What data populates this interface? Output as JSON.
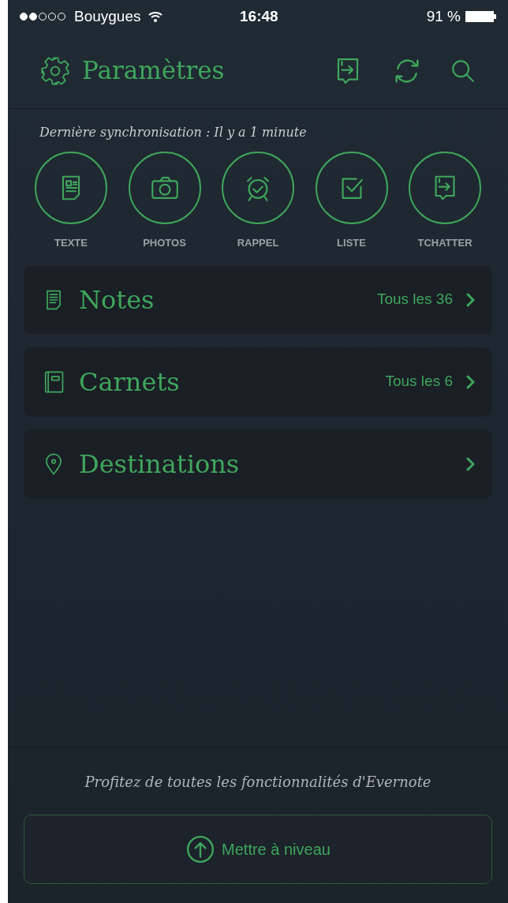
{
  "status_bar": {
    "carrier": "Bouygues",
    "time": "16:48",
    "battery": "91 %"
  },
  "header": {
    "title": "Paramètres"
  },
  "sync": "Dernière synchronisation : Il y a 1 minute",
  "quick_actions": [
    {
      "kind": "text",
      "label": "TEXTE"
    },
    {
      "kind": "camera",
      "label": "PHOTOS"
    },
    {
      "kind": "alarm",
      "label": "RAPPEL"
    },
    {
      "kind": "checklist",
      "label": "LISTE"
    },
    {
      "kind": "chat",
      "label": "TCHATTER"
    }
  ],
  "sections": [
    {
      "kind": "notes",
      "title": "Notes",
      "count": "Tous les 36"
    },
    {
      "kind": "notebooks",
      "title": "Carnets",
      "count": "Tous les 6"
    },
    {
      "kind": "places",
      "title": "Destinations"
    }
  ],
  "promo": "Profitez de toutes les fonctionnalités d'Evernote",
  "upgrade_button": "Mettre à niveau"
}
